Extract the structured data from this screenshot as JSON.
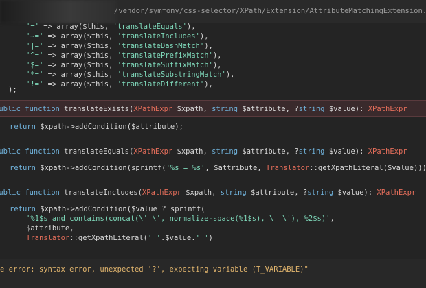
{
  "editor": {
    "file_path": "/vendor/symfony/css-selector/XPath/Extension/AttributeMatchingExtension.php",
    "lines": [
      {
        "segments": [
          [
            "str",
            "'='"
          ],
          [
            "var",
            " => array($this, "
          ],
          [
            "str",
            "'translateEquals'"
          ],
          [
            "var",
            "),"
          ]
        ]
      },
      {
        "segments": [
          [
            "str",
            "'~='"
          ],
          [
            "var",
            " => array($this, "
          ],
          [
            "str",
            "'translateIncludes'"
          ],
          [
            "var",
            "),"
          ]
        ]
      },
      {
        "segments": [
          [
            "str",
            "'|='"
          ],
          [
            "var",
            " => array($this, "
          ],
          [
            "str",
            "'translateDashMatch'"
          ],
          [
            "var",
            "),"
          ]
        ]
      },
      {
        "segments": [
          [
            "str",
            "'^='"
          ],
          [
            "var",
            " => array($this, "
          ],
          [
            "str",
            "'translatePrefixMatch'"
          ],
          [
            "var",
            "),"
          ]
        ]
      },
      {
        "segments": [
          [
            "str",
            "'$='"
          ],
          [
            "var",
            " => array($this, "
          ],
          [
            "str",
            "'translateSuffixMatch'"
          ],
          [
            "var",
            "),"
          ]
        ]
      },
      {
        "segments": [
          [
            "str",
            "'*='"
          ],
          [
            "var",
            " => array($this, "
          ],
          [
            "str",
            "'translateSubstringMatch'"
          ],
          [
            "var",
            "),"
          ]
        ]
      },
      {
        "segments": [
          [
            "str",
            "'!='"
          ],
          [
            "var",
            " => array($this, "
          ],
          [
            "str",
            "'translateDifferent'"
          ],
          [
            "var",
            "),"
          ]
        ]
      },
      {
        "segments": [
          [
            "var",
            ");"
          ]
        ]
      },
      {
        "segments": [
          [
            "kw",
            "public"
          ],
          [
            "var",
            " "
          ],
          [
            "kw",
            "function"
          ],
          [
            "var",
            " translateExists("
          ],
          [
            "type",
            "XPathExpr"
          ],
          [
            "var",
            " $xpath, "
          ],
          [
            "kw",
            "string"
          ],
          [
            "var",
            " $attribute, ?"
          ],
          [
            "kw",
            "string"
          ],
          [
            "var",
            " $value): "
          ],
          [
            "type",
            "XPathExpr"
          ]
        ]
      },
      {
        "segments": [
          [
            "kw",
            "return"
          ],
          [
            "var",
            " $xpath->addCondition($attribute);"
          ]
        ]
      },
      {
        "segments": [
          [
            "kw",
            "public"
          ],
          [
            "var",
            " "
          ],
          [
            "kw",
            "function"
          ],
          [
            "var",
            " translateEquals("
          ],
          [
            "type",
            "XPathExpr"
          ],
          [
            "var",
            " $xpath, "
          ],
          [
            "kw",
            "string"
          ],
          [
            "var",
            " $attribute, ?"
          ],
          [
            "kw",
            "string"
          ],
          [
            "var",
            " $value): "
          ],
          [
            "type",
            "XPathExpr"
          ]
        ]
      },
      {
        "segments": [
          [
            "kw",
            "return"
          ],
          [
            "var",
            " $xpath->addCondition(sprintf("
          ],
          [
            "str",
            "'%s = %s'"
          ],
          [
            "var",
            ", $attribute, "
          ],
          [
            "type",
            "Translator"
          ],
          [
            "var",
            "::getXpathLiteral($value)));"
          ]
        ]
      },
      {
        "segments": [
          [
            "kw",
            "public"
          ],
          [
            "var",
            " "
          ],
          [
            "kw",
            "function"
          ],
          [
            "var",
            " translateIncludes("
          ],
          [
            "type",
            "XPathExpr"
          ],
          [
            "var",
            " $xpath, "
          ],
          [
            "kw",
            "string"
          ],
          [
            "var",
            " $attribute, ?"
          ],
          [
            "kw",
            "string"
          ],
          [
            "var",
            " $value): "
          ],
          [
            "type",
            "XPathExpr"
          ]
        ]
      },
      {
        "segments": [
          [
            "kw",
            "return"
          ],
          [
            "var",
            " $xpath->addCondition($value ? sprintf("
          ]
        ]
      },
      {
        "segments": [
          [
            "str",
            "'%1$s and contains(concat(\\' \\', normalize-space(%1$s), \\' \\'), %2$s)'"
          ],
          [
            "var",
            ","
          ]
        ]
      },
      {
        "segments": [
          [
            "var",
            "$attribute,"
          ]
        ]
      },
      {
        "segments": [
          [
            "type",
            "Translator"
          ],
          [
            "var",
            "::getXpathLiteral("
          ],
          [
            "str",
            "' '"
          ],
          [
            "var",
            ".$value."
          ],
          [
            "str",
            "' '"
          ],
          [
            "var",
            ")"
          ]
        ]
      }
    ],
    "error_message": "e error: syntax error, unexpected '?', expecting variable (T_VARIABLE)\""
  }
}
